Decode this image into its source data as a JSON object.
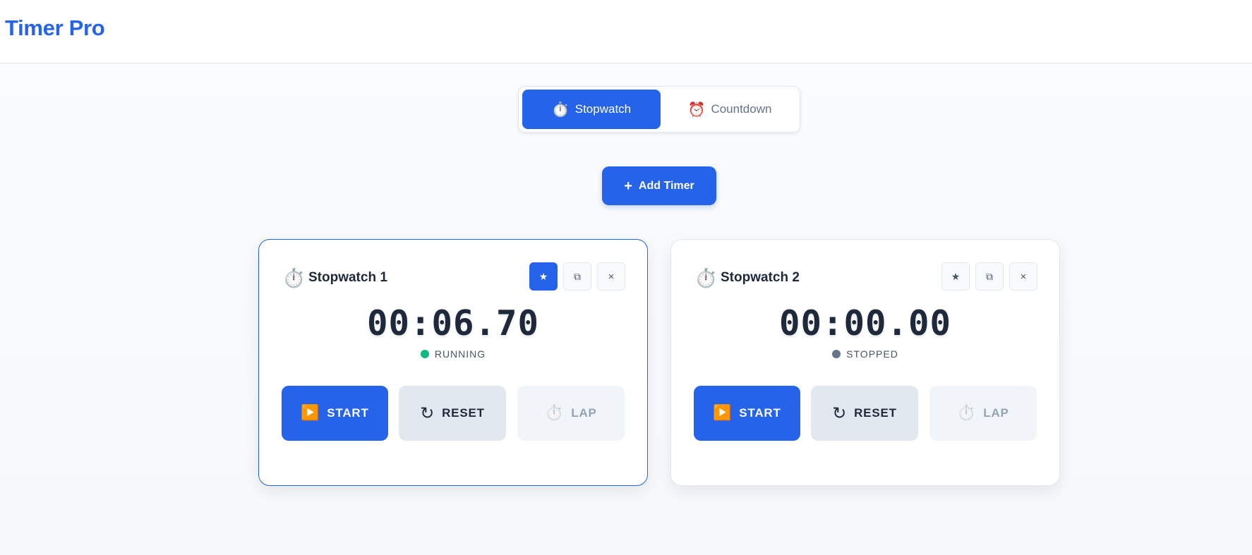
{
  "header": {
    "title": "Timer Pro"
  },
  "mode_switch": {
    "tabs": [
      {
        "label": "Stopwatch",
        "icon": "⏱️",
        "active": true
      },
      {
        "label": "Countdown",
        "icon": "⏰",
        "active": false
      }
    ]
  },
  "add_button": {
    "label": "Add Timer",
    "icon": "+"
  },
  "timers": [
    {
      "icon": "⏱️",
      "name": "Stopwatch 1",
      "time": "00:06.70",
      "status": "RUNNING",
      "status_color": "#10b981",
      "selected": true,
      "tools": {
        "star": "★",
        "copy": "⧉",
        "close": "×"
      },
      "actions": {
        "start": {
          "icon": "▶️",
          "label": "START"
        },
        "reset": {
          "icon": "↻",
          "label": "RESET"
        },
        "lap": {
          "icon": "⏱️",
          "label": "LAP"
        }
      }
    },
    {
      "icon": "⏱️",
      "name": "Stopwatch 2",
      "time": "00:00.00",
      "status": "STOPPED",
      "status_color": "#64748b",
      "selected": false,
      "tools": {
        "star": "★",
        "copy": "⧉",
        "close": "×"
      },
      "actions": {
        "start": {
          "icon": "▶️",
          "label": "START"
        },
        "reset": {
          "icon": "↻",
          "label": "RESET"
        },
        "lap": {
          "icon": "⏱️",
          "label": "LAP"
        }
      }
    }
  ],
  "colors": {
    "accent": "#2563eb",
    "running": "#10b981",
    "stopped": "#64748b"
  }
}
